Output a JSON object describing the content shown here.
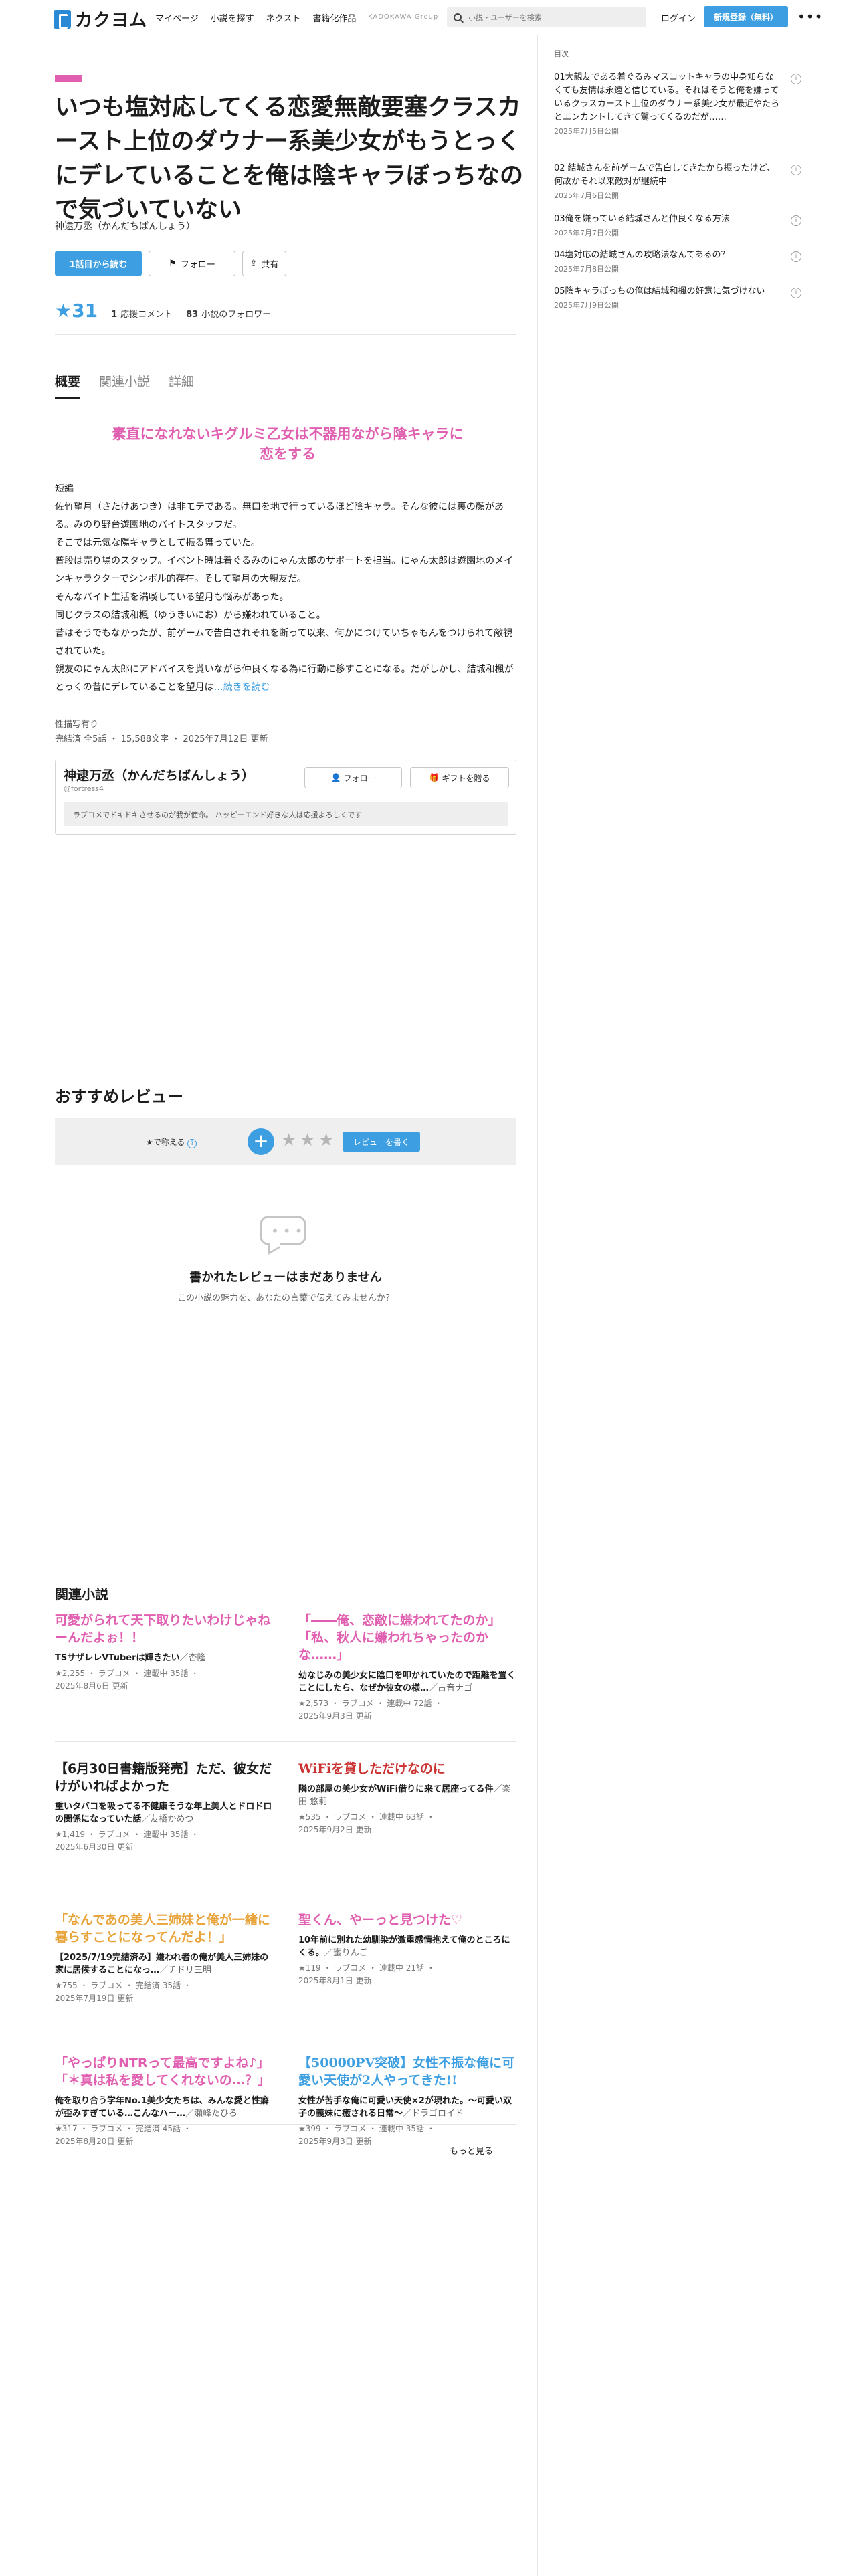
{
  "header": {
    "logo": "カクヨム",
    "nav": [
      "マイページ",
      "小説を探す",
      "ネクスト",
      "書籍化作品"
    ],
    "kadokawa": "KADOKAWA Group",
    "search_placeholder": "小説・ユーザーを検索",
    "login": "ログイン",
    "signup": "新規登録（無料）"
  },
  "work": {
    "title": "いつも塩対応してくる恋愛無敵要塞クラスカースト上位のダウナー系美少女がもうとっくにデレていることを俺は陰キャラぼっちなので気づいていない",
    "author": "神逮万丞（かんだちばんしょう）",
    "read_button": "1話目から読む",
    "follow_button": "フォロー",
    "share_button": "共有",
    "stars": "★31",
    "comments_num": "1",
    "comments_label": "応援コメント",
    "followers_num": "83",
    "followers_label": "小説のフォロワー"
  },
  "tabs": [
    "概要",
    "関連小説",
    "詳細"
  ],
  "overview": {
    "catch": "素直になれないキグルミ乙女は不器用ながら陰キャラに恋をする",
    "lines": [
      "短編",
      "佐竹望月（さたけあつき）は非モテである。無口を地で行っているほど陰キャラ。そんな彼には裏の顔がある。みのり野台遊園地のバイトスタッフだ。",
      "そこでは元気な陽キャラとして振る舞っていた。",
      "普段は売り場のスタッフ。イベント時は着ぐるみのにゃん太郎のサポートを担当。にゃん太郎は遊園地のメインキャラクターでシンボル的存在。そして望月の大親友だ。",
      "そんなバイト生活を満喫している望月も悩みがあった。",
      "同じクラスの結城和楓（ゆうきいにお）から嫌われていること。",
      "昔はそうでもなかったが、前ゲームで告白されそれを断って以来、何かにつけていちゃもんをつけられて敵視されていた。",
      "親友のにゃん太郎にアドバイスを貰いながら仲良くなる為に行動に移すことになる。だがしかし、結城和楓がとっくの昔にデレていることを望月は"
    ],
    "more": "…続きを読む",
    "tags": "性描写有り",
    "meta": "完結済 全5話 ・ 15,588文字 ・ 2025年7月12日 更新"
  },
  "author_card": {
    "name": "神逮万丞（かんだちばんしょう）",
    "handle": "@fortress4",
    "follow": "フォロー",
    "gift": "ギフトを贈る",
    "bio": "ラブコメでドキドキさせるのが我が使命。 ハッピーエンド好きな人は応援よろしくです"
  },
  "reviews": {
    "title": "おすすめレビュー",
    "teach": "★で称える",
    "write": "レビューを書く",
    "empty_title": "書かれたレビューはまだありません",
    "empty_sub": "この小説の魅力を、あなたの言葉で伝えてみませんか？"
  },
  "related": {
    "title": "関連小説",
    "see_more": "もっと見る",
    "items": [
      {
        "title": "可愛がられて天下取りたいわけじゃねーんだよぉ！！",
        "color": "#e05fb0",
        "catch": "TSサザレレVTuberは輝きたい",
        "author": "／杏隆",
        "meta1": "★2,255 ・ ラブコメ ・ 連載中 35話 ・",
        "meta2": "2025年8月6日 更新"
      },
      {
        "title": "「――俺、恋敵に嫌われてたのか」「私、秋人に嫌われちゃったのかな……」",
        "color": "#e05fb0",
        "catch": "幼なじみの美少女に陰口を叩かれていたので距離を置くことにしたら、なぜか彼女の様…",
        "author": "／古音ナゴ",
        "meta1": "★2,573 ・ ラブコメ ・ 連載中 72話 ・",
        "meta2": "2025年9月3日 更新"
      },
      {
        "title": "【6月30日書籍版発売】ただ、彼女だけがいればよかった",
        "color": "#1c1c1c",
        "catch": "重いタバコを吸ってる不健康そうな年上美人とドロドロの関係になっていた話",
        "author": "／友橋かめつ",
        "meta1": "★1,419 ・ ラブコメ ・ 連載中 35話 ・",
        "meta2": "2025年6月30日 更新"
      },
      {
        "title": "WiFiを貸しただけなのに",
        "color": "#cc3333",
        "catch": "隣の部屋の美少女がWiFi借りに来て居座ってる件",
        "author": "／楽田 悠莉",
        "meta1": "★535 ・ ラブコメ ・ 連載中 63話 ・",
        "meta2": "2025年9月2日 更新"
      },
      {
        "title": "「なんであの美人三姉妹と俺が一緒に暮らすことになってんだよ！」",
        "color": "#e8a33a",
        "catch": "【2025/7/19完結済み】嫌われ者の俺が美人三姉妹の家に居候することになっ…",
        "author": "／チドリ三明",
        "meta1": "★755 ・ ラブコメ ・ 完結済 35話 ・",
        "meta2": "2025年7月19日 更新"
      },
      {
        "title": "聖くん、やーっと見つけた♡",
        "color": "#e05fb0",
        "catch": "10年前に別れた幼馴染が激重感情抱えて俺のところにくる。",
        "author": "／蜜りんご",
        "meta1": "★119 ・ ラブコメ ・ 連載中 21話 ・",
        "meta2": "2025年8月1日 更新"
      },
      {
        "title": "「やっぱりNTRって最高ですよね♪」「＊真は私を愛してくれないの…？」",
        "color": "#e05fb0",
        "catch": "俺を取り合う学年No.1美少女たちは、みんな愛と性癖が歪みすぎている…こんなハー…",
        "author": "／瀬峰たひろ",
        "meta1": "★317 ・ ラブコメ ・ 完結済 45話 ・",
        "meta2": "2025年8月20日 更新"
      },
      {
        "title": "【50000PV突破】女性不振な俺に可愛い天使が2人やってきた!!",
        "color": "#3d9fe1",
        "catch": "女性が苦手な俺に可愛い天使×2が現れた。〜可愛い双子の義妹に癒される日常〜",
        "author": "／ドラゴロイド",
        "meta1": "★399 ・ ラブコメ ・ 連載中 35話 ・",
        "meta2": "2025年9月3日 更新"
      }
    ]
  },
  "toc": {
    "label": "目次",
    "items": [
      {
        "title": "01大親友である着ぐるみマスコットキャラの中身知らなくても友情は永遠と信じている。それはそうと俺を嫌っているクラスカースト上位のダウナー系美少女が最近やたらとエンカントしてきて駕ってくるのだが……",
        "date": "2025年7月5日公開"
      },
      {
        "title": "02 結城さんを前ゲームで告白してきたから振ったけど、何故かそれ以来敵対が継続中",
        "date": "2025年7月6日公開"
      },
      {
        "title": "03俺を嫌っている結城さんと仲良くなる方法",
        "date": "2025年7月7日公開"
      },
      {
        "title": "04塩対応の結城さんの攻略法なんてあるの？",
        "date": "2025年7月8日公開"
      },
      {
        "title": "05陰キャラぼっちの俺は結城和楓の好意に気づけない",
        "date": "2025年7月9日公開"
      }
    ]
  }
}
